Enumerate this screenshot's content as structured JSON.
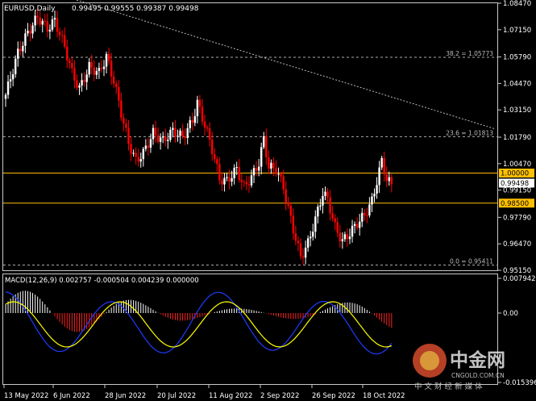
{
  "header": {
    "symbol": "EURUSD,Daily",
    "ohlc": "0.99495 0.99555 0.99387 0.99498"
  },
  "macd": {
    "label": "MACD(12,26,9) 0.002757 -0.000504 0.004239 0.000000"
  },
  "colors": {
    "background": "#000000",
    "bull": "#ffffff",
    "bear": "#ff0000",
    "macd_line": "#1e3cff",
    "signal_line": "#ffff00",
    "level_line": "#ffc000",
    "grid": "#c8c8c8"
  },
  "price_axis": {
    "ticks": [
      "1.08470",
      "1.07150",
      "1.05790",
      "1.04470",
      "1.03150",
      "1.01790",
      "1.00470",
      "0.99150",
      "0.97790",
      "0.96470",
      "0.95150"
    ],
    "tick_values": [
      1.0847,
      1.0715,
      1.0579,
      1.0447,
      1.0315,
      1.0179,
      1.0047,
      0.9915,
      0.9779,
      0.9647,
      0.9515
    ],
    "ylim": [
      0.9515,
      1.0847
    ],
    "current_price": "0.99498",
    "current_value": 0.99498
  },
  "levels": [
    {
      "value": 1.0,
      "label": "1.00000",
      "style": "solid"
    },
    {
      "value": 0.985,
      "label": "0.98500",
      "style": "solid"
    }
  ],
  "fib_levels": [
    {
      "value": 1.05773,
      "label": "38.2 = 1.05773"
    },
    {
      "value": 1.01813,
      "label": "23.6 = 1.01813"
    },
    {
      "value": 0.95411,
      "label": "0.0 = 0.95411"
    }
  ],
  "macd_axis": {
    "ticks": [
      "0.007942",
      "0.00",
      "-0.015396"
    ],
    "tick_values": [
      0.007942,
      0,
      -0.015396
    ]
  },
  "date_axis": {
    "labels": [
      "13 May 2022",
      "6 Jun 2022",
      "28 Jun 2022",
      "20 Jul 2022",
      "11 Aug 2022",
      "2 Sep 2022",
      "26 Sep 2022",
      "18 Oct 2022"
    ]
  },
  "watermark": {
    "brand": "中金网",
    "domain": "CNGOLD.COM.CN",
    "tagline": "中 文 财 经 新 媒 体"
  }
}
